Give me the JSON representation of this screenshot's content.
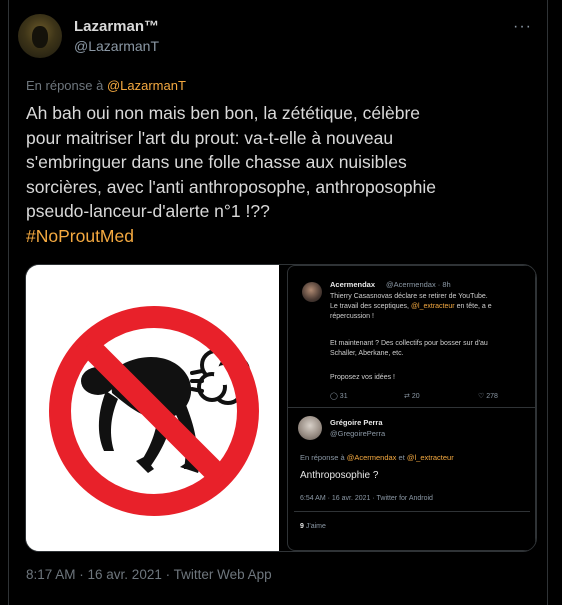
{
  "author": {
    "name": "Lazarman™",
    "handle": "@LazarmanT"
  },
  "reply": {
    "prefix": "En réponse à",
    "mention": "@LazarmanT"
  },
  "tweet": {
    "lines": [
      "Ah bah oui non mais ben bon, la zététique, célèbre",
      "pour maitriser l'art du prout: va-t-elle à nouveau",
      "s'embringuer dans une folle chasse aux nuisibles",
      "sorcières, avec l'anti anthroposophe, anthroposophie",
      "pseudo-lanceur-d'alerte n°1 !??"
    ],
    "hashtag": "#NoProutMed"
  },
  "embedded": {
    "tweet1": {
      "name": "Acermendax",
      "handle": "@Acermendax · 8h",
      "line1": "Thierry Casasnovas déclare se retirer de YouTube.",
      "line2_pre": "Le travail des sceptiques, ",
      "line2_mention": "@l_extracteur",
      "line2_post": " en tête, a e",
      "line3": "répercussion !",
      "line4": "Et maintenant ? Des collectifs pour bosser sur d'au",
      "line5": "Schaller, Aberkane, etc.",
      "line6": "Proposez vos idées !",
      "replies": "31",
      "retweets": "20",
      "likes": "278"
    },
    "tweet2": {
      "name": "Grégoire Perra",
      "handle": "@GregoirePerra",
      "reply_prefix": "En réponse à",
      "mention1": "@Acermendax",
      "reply_and": "et",
      "mention2": "@l_extracteur",
      "text": "Anthroposophie ?",
      "meta": "6:54 AM · 16 avr. 2021 · Twitter for Android",
      "likes_count": "9",
      "likes_label": "J'aime"
    }
  },
  "timestamp": "8:17 AM · 16 avr. 2021 · Twitter Web App",
  "colors": {
    "accent": "#f4a940",
    "background": "#000000",
    "muted": "#6e767d",
    "text": "#d9d9d9",
    "prohibition_red": "#e8212a"
  },
  "icons": [
    "more-icon",
    "no-fart-sign-icon",
    "reply-icon",
    "retweet-icon",
    "like-icon"
  ]
}
